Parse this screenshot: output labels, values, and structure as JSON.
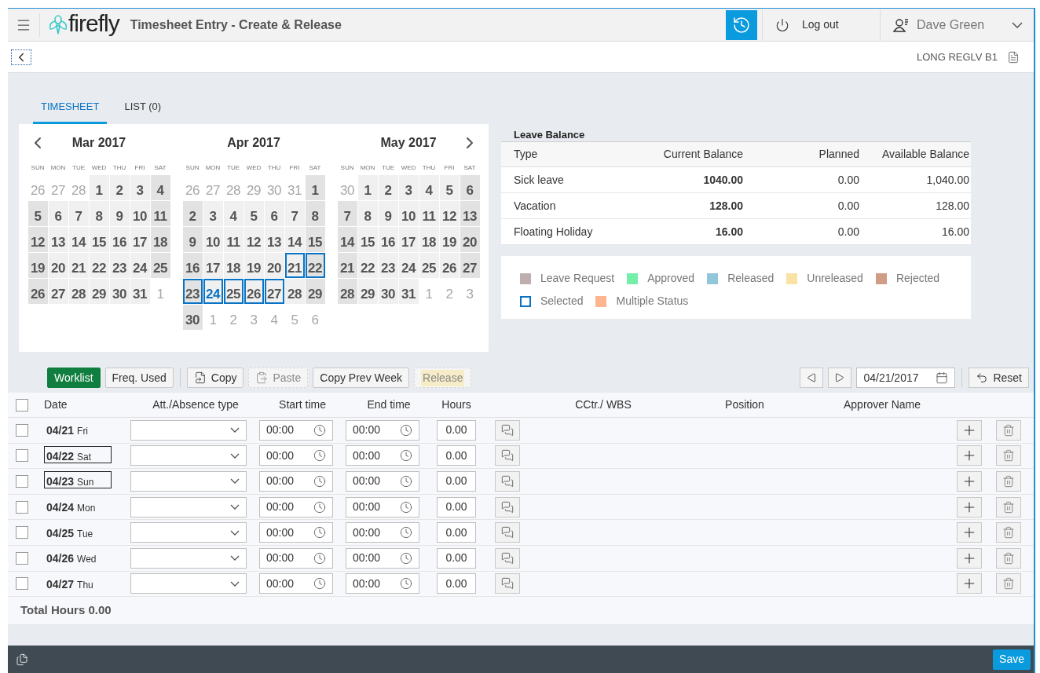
{
  "header": {
    "title": "Timesheet Entry - Create & Release",
    "logo": "firefly",
    "logout": "Log out",
    "user": "Dave Green"
  },
  "subheader": {
    "code": "LONG REGLV B1"
  },
  "tabs": [
    {
      "label": "TIMESHEET",
      "selected": true
    },
    {
      "label": "LIST (0)",
      "selected": false
    }
  ],
  "calendar": {
    "months": [
      {
        "title": "Mar 2017",
        "weekdays": [
          "SUN",
          "MON",
          "TUE",
          "WED",
          "THU",
          "FRI",
          "SAT"
        ],
        "weeks": [
          [
            {
              "n": "26",
              "kind": "outside",
              "selected": false
            },
            {
              "n": "27",
              "kind": "outside",
              "selected": false
            },
            {
              "n": "28",
              "kind": "outside",
              "selected": false
            },
            {
              "n": "1",
              "kind": "day",
              "selected": false
            },
            {
              "n": "2",
              "kind": "day",
              "selected": false
            },
            {
              "n": "3",
              "kind": "day",
              "selected": false
            },
            {
              "n": "4",
              "kind": "day",
              "selected": false
            }
          ],
          [
            {
              "n": "5",
              "kind": "day",
              "selected": false
            },
            {
              "n": "6",
              "kind": "day",
              "selected": false
            },
            {
              "n": "7",
              "kind": "day",
              "selected": false
            },
            {
              "n": "8",
              "kind": "day",
              "selected": false
            },
            {
              "n": "9",
              "kind": "day",
              "selected": false
            },
            {
              "n": "10",
              "kind": "day",
              "selected": false
            },
            {
              "n": "11",
              "kind": "day",
              "selected": false
            }
          ],
          [
            {
              "n": "12",
              "kind": "day",
              "selected": false
            },
            {
              "n": "13",
              "kind": "day",
              "selected": false
            },
            {
              "n": "14",
              "kind": "day",
              "selected": false
            },
            {
              "n": "15",
              "kind": "day",
              "selected": false
            },
            {
              "n": "16",
              "kind": "day",
              "selected": false
            },
            {
              "n": "17",
              "kind": "day",
              "selected": false
            },
            {
              "n": "18",
              "kind": "day",
              "selected": false
            }
          ],
          [
            {
              "n": "19",
              "kind": "day",
              "selected": false
            },
            {
              "n": "20",
              "kind": "day",
              "selected": false
            },
            {
              "n": "21",
              "kind": "day",
              "selected": false
            },
            {
              "n": "22",
              "kind": "day",
              "selected": false
            },
            {
              "n": "23",
              "kind": "day",
              "selected": false
            },
            {
              "n": "24",
              "kind": "day",
              "selected": false
            },
            {
              "n": "25",
              "kind": "day",
              "selected": false
            }
          ],
          [
            {
              "n": "26",
              "kind": "day",
              "selected": false
            },
            {
              "n": "27",
              "kind": "day",
              "selected": false
            },
            {
              "n": "28",
              "kind": "day",
              "selected": false
            },
            {
              "n": "29",
              "kind": "day",
              "selected": false
            },
            {
              "n": "30",
              "kind": "day",
              "selected": false
            },
            {
              "n": "31",
              "kind": "day",
              "selected": false
            },
            {
              "n": "1",
              "kind": "outside",
              "selected": false
            }
          ]
        ]
      },
      {
        "title": "Apr 2017",
        "weekdays": [
          "SUN",
          "MON",
          "TUE",
          "WED",
          "THU",
          "FRI",
          "SAT"
        ],
        "weeks": [
          [
            {
              "n": "26",
              "kind": "outside",
              "selected": false
            },
            {
              "n": "27",
              "kind": "outside",
              "selected": false
            },
            {
              "n": "28",
              "kind": "outside",
              "selected": false
            },
            {
              "n": "29",
              "kind": "outside",
              "selected": false
            },
            {
              "n": "30",
              "kind": "outside",
              "selected": false
            },
            {
              "n": "31",
              "kind": "outside",
              "selected": false
            },
            {
              "n": "1",
              "kind": "day",
              "selected": false
            }
          ],
          [
            {
              "n": "2",
              "kind": "day",
              "selected": false
            },
            {
              "n": "3",
              "kind": "day",
              "selected": false
            },
            {
              "n": "4",
              "kind": "day",
              "selected": false
            },
            {
              "n": "5",
              "kind": "day",
              "selected": false
            },
            {
              "n": "6",
              "kind": "day",
              "selected": false
            },
            {
              "n": "7",
              "kind": "day",
              "selected": false
            },
            {
              "n": "8",
              "kind": "day",
              "selected": false
            }
          ],
          [
            {
              "n": "9",
              "kind": "day",
              "selected": false
            },
            {
              "n": "10",
              "kind": "day",
              "selected": false
            },
            {
              "n": "11",
              "kind": "day",
              "selected": false
            },
            {
              "n": "12",
              "kind": "day",
              "selected": false
            },
            {
              "n": "13",
              "kind": "day",
              "selected": false
            },
            {
              "n": "14",
              "kind": "day",
              "selected": false
            },
            {
              "n": "15",
              "kind": "day",
              "selected": false
            }
          ],
          [
            {
              "n": "16",
              "kind": "day",
              "selected": false
            },
            {
              "n": "17",
              "kind": "day",
              "selected": false
            },
            {
              "n": "18",
              "kind": "day",
              "selected": false
            },
            {
              "n": "19",
              "kind": "day",
              "selected": false
            },
            {
              "n": "20",
              "kind": "day",
              "selected": false
            },
            {
              "n": "21",
              "kind": "day",
              "selected": true
            },
            {
              "n": "22",
              "kind": "day",
              "selected": true
            }
          ],
          [
            {
              "n": "23",
              "kind": "day",
              "selected": true
            },
            {
              "n": "24",
              "kind": "today",
              "selected": true
            },
            {
              "n": "25",
              "kind": "day",
              "selected": true
            },
            {
              "n": "26",
              "kind": "day",
              "selected": true
            },
            {
              "n": "27",
              "kind": "day",
              "selected": true
            },
            {
              "n": "28",
              "kind": "day",
              "selected": false
            },
            {
              "n": "29",
              "kind": "day",
              "selected": false
            }
          ],
          [
            {
              "n": "30",
              "kind": "day",
              "selected": false
            },
            {
              "n": "1",
              "kind": "outside",
              "selected": false
            },
            {
              "n": "2",
              "kind": "outside",
              "selected": false
            },
            {
              "n": "3",
              "kind": "outside",
              "selected": false
            },
            {
              "n": "4",
              "kind": "outside",
              "selected": false
            },
            {
              "n": "5",
              "kind": "outside",
              "selected": false
            },
            {
              "n": "6",
              "kind": "outside",
              "selected": false
            }
          ]
        ]
      },
      {
        "title": "May 2017",
        "weekdays": [
          "SUN",
          "MON",
          "TUE",
          "WED",
          "THU",
          "FRI",
          "SAT"
        ],
        "weeks": [
          [
            {
              "n": "30",
              "kind": "outside",
              "selected": false
            },
            {
              "n": "1",
              "kind": "day",
              "selected": false
            },
            {
              "n": "2",
              "kind": "day",
              "selected": false
            },
            {
              "n": "3",
              "kind": "day",
              "selected": false
            },
            {
              "n": "4",
              "kind": "day",
              "selected": false
            },
            {
              "n": "5",
              "kind": "day",
              "selected": false
            },
            {
              "n": "6",
              "kind": "day",
              "selected": false
            }
          ],
          [
            {
              "n": "7",
              "kind": "day",
              "selected": false
            },
            {
              "n": "8",
              "kind": "day",
              "selected": false
            },
            {
              "n": "9",
              "kind": "day",
              "selected": false
            },
            {
              "n": "10",
              "kind": "day",
              "selected": false
            },
            {
              "n": "11",
              "kind": "day",
              "selected": false
            },
            {
              "n": "12",
              "kind": "day",
              "selected": false
            },
            {
              "n": "13",
              "kind": "day",
              "selected": false
            }
          ],
          [
            {
              "n": "14",
              "kind": "day",
              "selected": false
            },
            {
              "n": "15",
              "kind": "day",
              "selected": false
            },
            {
              "n": "16",
              "kind": "day",
              "selected": false
            },
            {
              "n": "17",
              "kind": "day",
              "selected": false
            },
            {
              "n": "18",
              "kind": "day",
              "selected": false
            },
            {
              "n": "19",
              "kind": "day",
              "selected": false
            },
            {
              "n": "20",
              "kind": "day",
              "selected": false
            }
          ],
          [
            {
              "n": "21",
              "kind": "day",
              "selected": false
            },
            {
              "n": "22",
              "kind": "day",
              "selected": false
            },
            {
              "n": "23",
              "kind": "day",
              "selected": false
            },
            {
              "n": "24",
              "kind": "day",
              "selected": false
            },
            {
              "n": "25",
              "kind": "day",
              "selected": false
            },
            {
              "n": "26",
              "kind": "day",
              "selected": false
            },
            {
              "n": "27",
              "kind": "day",
              "selected": false
            }
          ],
          [
            {
              "n": "28",
              "kind": "day",
              "selected": false
            },
            {
              "n": "29",
              "kind": "day",
              "selected": false
            },
            {
              "n": "30",
              "kind": "day",
              "selected": false
            },
            {
              "n": "31",
              "kind": "day",
              "selected": false
            },
            {
              "n": "1",
              "kind": "outside",
              "selected": false
            },
            {
              "n": "2",
              "kind": "outside",
              "selected": false
            },
            {
              "n": "3",
              "kind": "outside",
              "selected": false
            }
          ]
        ]
      }
    ]
  },
  "leave_balance": {
    "title": "Leave Balance",
    "columns": [
      "Type",
      "Current Balance",
      "Planned",
      "Available Balance"
    ],
    "rows": [
      {
        "type": "Sick leave",
        "current": "1040.00",
        "planned": "0.00",
        "available": "1,040.00"
      },
      {
        "type": "Vacation",
        "current": "128.00",
        "planned": "0.00",
        "available": "128.00"
      },
      {
        "type": "Floating Holiday",
        "current": "16.00",
        "planned": "0.00",
        "available": "16.00"
      }
    ]
  },
  "legend": [
    {
      "label": "Leave Request",
      "kind": "fill",
      "color": "#bfaeae"
    },
    {
      "label": "Approved",
      "kind": "fill",
      "color": "#73efa9"
    },
    {
      "label": "Released",
      "kind": "fill",
      "color": "#92c6da"
    },
    {
      "label": "Unreleased",
      "kind": "fill",
      "color": "#f9e2a4"
    },
    {
      "label": "Rejected",
      "kind": "fill",
      "color": "#d19c86"
    },
    {
      "label": "Selected",
      "kind": "outline",
      "color": "#0a74c4"
    },
    {
      "label": "Multiple Status",
      "kind": "fill",
      "color": "#fdb590"
    }
  ],
  "toolbar": {
    "buttons": [
      {
        "label": "Worklist",
        "kind": "primary",
        "disabled": false
      },
      {
        "label": "Freq. Used",
        "kind": "plain",
        "disabled": false
      },
      {
        "label": "Copy",
        "kind": "copy",
        "disabled": false
      },
      {
        "label": "Paste",
        "kind": "paste",
        "disabled": true
      },
      {
        "label": "Copy Prev Week",
        "kind": "plain",
        "disabled": false
      },
      {
        "label": "Release",
        "kind": "release",
        "disabled": true
      }
    ],
    "date": "04/21/2017",
    "reset": "Reset"
  },
  "table": {
    "select_all_checked": false,
    "columns": [
      "Date",
      "Att./Absence type",
      "Start time",
      "End time",
      "Hours",
      "CCtr./ WBS",
      "Position",
      "Approver Name"
    ],
    "rows": [
      {
        "date": "04/21",
        "day": "Fri",
        "outlined": false,
        "checked": false,
        "start": "00:00",
        "end": "00:00",
        "hours": "0.00"
      },
      {
        "date": "04/22",
        "day": "Sat",
        "outlined": true,
        "checked": false,
        "start": "00:00",
        "end": "00:00",
        "hours": "0.00"
      },
      {
        "date": "04/23",
        "day": "Sun",
        "outlined": true,
        "checked": false,
        "start": "00:00",
        "end": "00:00",
        "hours": "0.00"
      },
      {
        "date": "04/24",
        "day": "Mon",
        "outlined": false,
        "checked": false,
        "start": "00:00",
        "end": "00:00",
        "hours": "0.00"
      },
      {
        "date": "04/25",
        "day": "Tue",
        "outlined": false,
        "checked": false,
        "start": "00:00",
        "end": "00:00",
        "hours": "0.00"
      },
      {
        "date": "04/26",
        "day": "Wed",
        "outlined": false,
        "checked": false,
        "start": "00:00",
        "end": "00:00",
        "hours": "0.00"
      },
      {
        "date": "04/27",
        "day": "Thu",
        "outlined": false,
        "checked": false,
        "start": "00:00",
        "end": "00:00",
        "hours": "0.00"
      }
    ],
    "total": "Total Hours 0.00"
  },
  "footer": {
    "save": "Save"
  }
}
